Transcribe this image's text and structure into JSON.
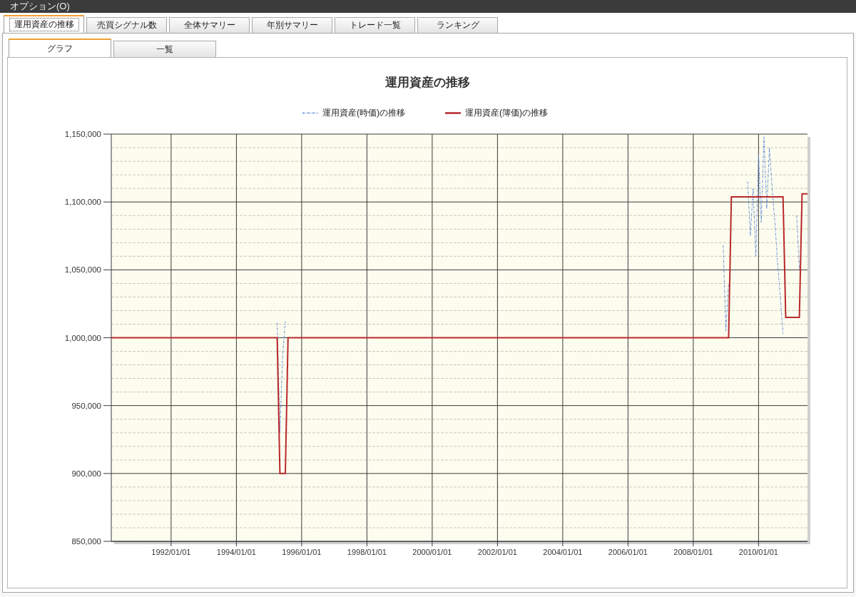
{
  "menu_bar": {
    "items": [
      "オプション(O)"
    ]
  },
  "tabs": [
    {
      "label": "運用資産の推移",
      "selected": true
    },
    {
      "label": "売買シグナル数",
      "selected": false
    },
    {
      "label": "全体サマリー",
      "selected": false
    },
    {
      "label": "年別サマリー",
      "selected": false
    },
    {
      "label": "トレード一覧",
      "selected": false
    },
    {
      "label": "ランキング",
      "selected": false
    }
  ],
  "view_tabs": [
    {
      "label": "グラフ",
      "selected": true
    },
    {
      "label": "一覧",
      "selected": false
    }
  ],
  "chart": {
    "chart_data": {
      "type": "line",
      "title": "運用資産の推移",
      "grid": true,
      "categories": [
        null,
        null,
        null,
        null,
        null,
        null,
        null,
        null,
        null,
        null,
        null,
        null,
        null,
        null,
        null,
        null,
        null,
        null,
        null,
        null,
        null,
        null,
        "1992/01/01",
        null,
        null,
        null,
        null,
        null,
        null,
        null,
        null,
        null,
        null,
        null,
        null,
        null,
        null,
        null,
        null,
        null,
        null,
        null,
        null,
        null,
        null,
        null,
        "1994/01/01",
        null,
        null,
        null,
        null,
        null,
        null,
        null,
        null,
        null,
        null,
        null,
        null,
        null,
        null,
        null,
        null,
        null,
        null,
        null,
        null,
        null,
        null,
        null,
        "1996/01/01",
        null,
        null,
        null,
        null,
        null,
        null,
        null,
        null,
        null,
        null,
        null,
        null,
        null,
        null,
        null,
        null,
        null,
        null,
        null,
        null,
        null,
        null,
        null,
        "1998/01/01",
        null,
        null,
        null,
        null,
        null,
        null,
        null,
        null,
        null,
        null,
        null,
        null,
        null,
        null,
        null,
        null,
        null,
        null,
        null,
        null,
        null,
        null,
        null,
        "2000/01/01",
        null,
        null,
        null,
        null,
        null,
        null,
        null,
        null,
        null,
        null,
        null,
        null,
        null,
        null,
        null,
        null,
        null,
        null,
        null,
        null,
        null,
        null,
        null,
        "2002/01/01",
        null,
        null,
        null,
        null,
        null,
        null,
        null,
        null,
        null,
        null,
        null,
        null,
        null,
        null,
        null,
        null,
        null,
        null,
        null,
        null,
        null,
        null,
        null,
        "2004/01/01",
        null,
        null,
        null,
        null,
        null,
        null,
        null,
        null,
        null,
        null,
        null,
        null,
        null,
        null,
        null,
        null,
        null,
        null,
        null,
        null,
        null,
        null,
        null,
        "2006/01/01",
        null,
        null,
        null,
        null,
        null,
        null,
        null,
        null,
        null,
        null,
        null,
        null,
        null,
        null,
        null,
        null,
        null,
        null,
        null,
        null,
        null,
        null,
        null,
        "2008/01/01",
        null,
        null,
        null,
        null,
        null,
        null,
        null,
        null,
        null,
        null,
        null,
        null,
        null,
        null,
        null,
        null,
        null,
        null,
        null,
        null,
        null,
        null,
        null,
        "2010/01/01",
        null,
        null,
        null,
        null,
        null,
        null,
        null,
        null,
        null,
        null,
        null,
        null,
        null,
        null,
        null,
        null,
        null,
        null
      ],
      "series": [
        {
          "name": "運用資産(時価)の推移",
          "color": "#5b86d6",
          "line_style": "dashdot",
          "values": [
            null,
            null,
            null,
            null,
            null,
            null,
            null,
            null,
            null,
            null,
            null,
            null,
            null,
            null,
            null,
            null,
            null,
            null,
            null,
            null,
            null,
            null,
            null,
            null,
            null,
            null,
            null,
            null,
            null,
            null,
            null,
            null,
            null,
            null,
            null,
            null,
            null,
            null,
            null,
            null,
            null,
            null,
            null,
            null,
            null,
            null,
            null,
            null,
            null,
            null,
            null,
            null,
            null,
            null,
            null,
            null,
            null,
            null,
            null,
            null,
            null,
            1011000,
            930000,
            987000,
            1012000,
            null,
            null,
            null,
            null,
            null,
            null,
            null,
            null,
            null,
            null,
            null,
            null,
            null,
            null,
            null,
            null,
            null,
            null,
            null,
            null,
            null,
            null,
            null,
            null,
            null,
            null,
            null,
            null,
            null,
            null,
            null,
            null,
            null,
            null,
            null,
            null,
            null,
            null,
            null,
            null,
            null,
            null,
            null,
            null,
            null,
            null,
            null,
            null,
            null,
            null,
            null,
            null,
            null,
            null,
            null,
            null,
            null,
            null,
            null,
            null,
            null,
            null,
            null,
            null,
            null,
            null,
            null,
            null,
            null,
            null,
            null,
            null,
            null,
            null,
            null,
            null,
            null,
            null,
            null,
            null,
            null,
            null,
            null,
            null,
            null,
            null,
            null,
            null,
            null,
            null,
            null,
            null,
            null,
            null,
            null,
            null,
            null,
            null,
            null,
            null,
            null,
            null,
            null,
            null,
            null,
            null,
            null,
            null,
            null,
            null,
            null,
            null,
            null,
            null,
            null,
            null,
            null,
            null,
            null,
            null,
            null,
            null,
            null,
            null,
            null,
            null,
            null,
            null,
            null,
            null,
            null,
            null,
            null,
            null,
            null,
            null,
            null,
            null,
            null,
            null,
            null,
            null,
            null,
            null,
            null,
            null,
            null,
            null,
            null,
            null,
            null,
            null,
            null,
            null,
            null,
            null,
            null,
            null,
            null,
            null,
            1068000,
            1005000,
            1040000,
            null,
            null,
            null,
            null,
            null,
            null,
            1115000,
            1075000,
            1110000,
            1060000,
            1135000,
            1085000,
            1148000,
            1095000,
            1140000,
            1110000,
            1085000,
            1055000,
            1030000,
            1003000,
            null,
            null,
            null,
            null,
            1090000,
            1050000,
            null,
            null,
            null
          ]
        },
        {
          "name": "運用資産(簿価)の推移",
          "color": "#b8282a",
          "line_style": "solid",
          "values": [
            1000000,
            1000000,
            1000000,
            1000000,
            1000000,
            1000000,
            1000000,
            1000000,
            1000000,
            1000000,
            1000000,
            1000000,
            1000000,
            1000000,
            1000000,
            1000000,
            1000000,
            1000000,
            1000000,
            1000000,
            1000000,
            1000000,
            1000000,
            1000000,
            1000000,
            1000000,
            1000000,
            1000000,
            1000000,
            1000000,
            1000000,
            1000000,
            1000000,
            1000000,
            1000000,
            1000000,
            1000000,
            1000000,
            1000000,
            1000000,
            1000000,
            1000000,
            1000000,
            1000000,
            1000000,
            1000000,
            1000000,
            1000000,
            1000000,
            1000000,
            1000000,
            1000000,
            1000000,
            1000000,
            1000000,
            1000000,
            1000000,
            1000000,
            1000000,
            1000000,
            1000000,
            1000000,
            900000,
            900000,
            900000,
            1000000,
            1000000,
            1000000,
            1000000,
            1000000,
            1000000,
            1000000,
            1000000,
            1000000,
            1000000,
            1000000,
            1000000,
            1000000,
            1000000,
            1000000,
            1000000,
            1000000,
            1000000,
            1000000,
            1000000,
            1000000,
            1000000,
            1000000,
            1000000,
            1000000,
            1000000,
            1000000,
            1000000,
            1000000,
            1000000,
            1000000,
            1000000,
            1000000,
            1000000,
            1000000,
            1000000,
            1000000,
            1000000,
            1000000,
            1000000,
            1000000,
            1000000,
            1000000,
            1000000,
            1000000,
            1000000,
            1000000,
            1000000,
            1000000,
            1000000,
            1000000,
            1000000,
            1000000,
            1000000,
            1000000,
            1000000,
            1000000,
            1000000,
            1000000,
            1000000,
            1000000,
            1000000,
            1000000,
            1000000,
            1000000,
            1000000,
            1000000,
            1000000,
            1000000,
            1000000,
            1000000,
            1000000,
            1000000,
            1000000,
            1000000,
            1000000,
            1000000,
            1000000,
            1000000,
            1000000,
            1000000,
            1000000,
            1000000,
            1000000,
            1000000,
            1000000,
            1000000,
            1000000,
            1000000,
            1000000,
            1000000,
            1000000,
            1000000,
            1000000,
            1000000,
            1000000,
            1000000,
            1000000,
            1000000,
            1000000,
            1000000,
            1000000,
            1000000,
            1000000,
            1000000,
            1000000,
            1000000,
            1000000,
            1000000,
            1000000,
            1000000,
            1000000,
            1000000,
            1000000,
            1000000,
            1000000,
            1000000,
            1000000,
            1000000,
            1000000,
            1000000,
            1000000,
            1000000,
            1000000,
            1000000,
            1000000,
            1000000,
            1000000,
            1000000,
            1000000,
            1000000,
            1000000,
            1000000,
            1000000,
            1000000,
            1000000,
            1000000,
            1000000,
            1000000,
            1000000,
            1000000,
            1000000,
            1000000,
            1000000,
            1000000,
            1000000,
            1000000,
            1000000,
            1000000,
            1000000,
            1000000,
            1000000,
            1000000,
            1000000,
            1000000,
            1000000,
            1000000,
            1000000,
            1000000,
            1000000,
            1000000,
            1000000,
            1000000,
            1103700,
            1103700,
            1103700,
            1103700,
            1103700,
            1103700,
            1103700,
            1103700,
            1103700,
            1103700,
            1103700,
            1103700,
            1103700,
            1103700,
            1103700,
            1103700,
            1103700,
            1103700,
            1103700,
            1103700,
            1015000,
            1015000,
            1015000,
            1015000,
            1015000,
            1015000,
            1106000,
            1106000,
            1106000
          ]
        }
      ],
      "ylim": [
        850000,
        1150000
      ],
      "yticks": [
        {
          "value": 850000,
          "label": "850,000"
        },
        {
          "value": 900000,
          "label": "900,000"
        },
        {
          "value": 950000,
          "label": "950,000"
        },
        {
          "value": 1000000,
          "label": "1,000,000"
        },
        {
          "value": 1050000,
          "label": "1,050,000"
        },
        {
          "value": 1100000,
          "label": "1,100,000"
        },
        {
          "value": 1150000,
          "label": "1,150,000"
        }
      ]
    }
  }
}
